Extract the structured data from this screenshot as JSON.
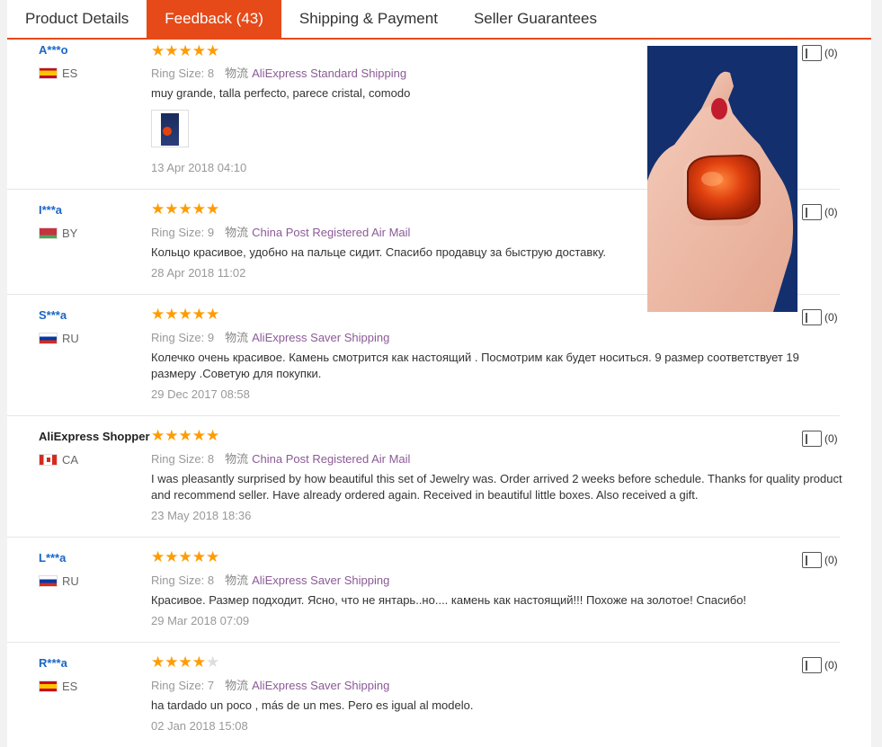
{
  "tabs": [
    {
      "label": "Product Details",
      "active": false
    },
    {
      "label": "Feedback (43)",
      "active": true
    },
    {
      "label": "Shipping & Payment",
      "active": false
    },
    {
      "label": "Seller Guarantees",
      "active": false
    }
  ],
  "reviews": [
    {
      "name": "A***o",
      "country": "ES",
      "stars": 5,
      "size_label": "Ring Size:",
      "size": "8",
      "cn": "物流",
      "shipping": "AliExpress Standard Shipping",
      "text": "muy grande, talla perfecto, parece cristal, comodo",
      "date": "13 Apr 2018 04:10",
      "likes": "(0)",
      "has_photo": true
    },
    {
      "name": "I***a",
      "country": "BY",
      "stars": 5,
      "size_label": "Ring Size:",
      "size": "9",
      "cn": "物流",
      "shipping": "China Post Registered Air Mail",
      "text": "Кольцо красивое, удобно на пальце сидит. Спасибо продавцу за быструю доставку.",
      "date": "28 Apr 2018 11:02",
      "likes": "(0)"
    },
    {
      "name": "S***a",
      "country": "RU",
      "stars": 5,
      "size_label": "Ring Size:",
      "size": "9",
      "cn": "物流",
      "shipping": "AliExpress Saver Shipping",
      "text": "Колечко очень красивое. Камень смотрится как настоящий . Посмотрим как будет носиться. 9 размер соответствует 19 размеру .Советую для покупки.",
      "date": "29 Dec 2017 08:58",
      "likes": "(0)"
    },
    {
      "name": "AliExpress Shopper",
      "country": "CA",
      "stars": 5,
      "size_label": "Ring Size:",
      "size": "8",
      "cn": "物流",
      "shipping": "China Post Registered Air Mail",
      "text": "I was pleasantly surprised by how beautiful this set of Jewelry was. Order arrived 2 weeks before schedule. Thanks for quality product and recommend seller. Have already ordered again. Received in beautiful little boxes. Also received a gift.",
      "date": "23 May 2018 18:36",
      "likes": "(0)"
    },
    {
      "name": "L***a",
      "country": "RU",
      "stars": 5,
      "size_label": "Ring Size:",
      "size": "8",
      "cn": "物流",
      "shipping": "AliExpress Saver Shipping",
      "text": "Красивое. Размер подходит. Ясно, что не янтарь..но.... камень как настоящий!!! Похоже на золотое! Спасибо!",
      "date": "29 Mar 2018 07:09",
      "likes": "(0)"
    },
    {
      "name": "R***a",
      "country": "ES",
      "stars": 4,
      "size_label": "Ring Size:",
      "size": "7",
      "cn": "物流",
      "shipping": "AliExpress Saver Shipping",
      "text": "ha tardado un poco , más de un mes. Pero es igual al modelo.",
      "date": "02 Jan 2018 15:08",
      "likes": "(0)"
    }
  ],
  "colors": {
    "accent": "#e64a19",
    "star": "#ff9c00",
    "link": "#1a66c7"
  }
}
